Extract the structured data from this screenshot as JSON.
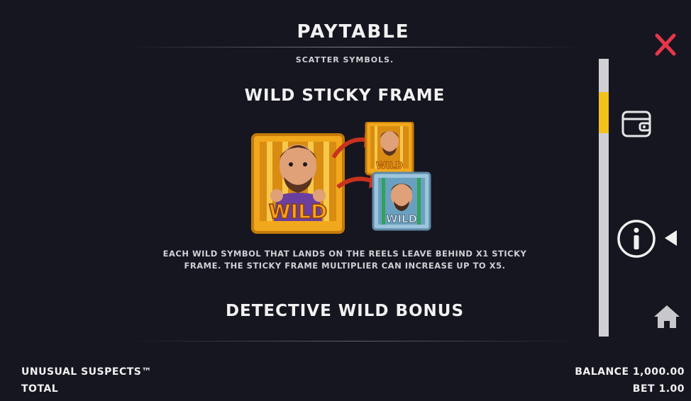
{
  "header": {
    "title": "PAYTABLE"
  },
  "content": {
    "top_cut_text": "SCATTER SYMBOLS.",
    "sections": [
      {
        "title": "WILD STICKY FRAME",
        "illustration_text": "WILD",
        "description_line1": "EACH WILD SYMBOL THAT LANDS ON THE REELS LEAVE BEHIND X1 STICKY",
        "description_line2": "FRAME. THE STICKY FRAME MULTIPLIER CAN INCREASE UP TO X5."
      },
      {
        "title": "DETECTIVE WILD BONUS"
      }
    ]
  },
  "scrollbar": {
    "position_fraction": 0.14
  },
  "sidebar": {
    "icons": [
      "wallet-icon",
      "info-icon",
      "triangle-left-icon",
      "home-icon"
    ]
  },
  "footer": {
    "game_name": "UNUSUAL SUSPECTS™",
    "total_label": "TOTAL",
    "balance_label": "BALANCE",
    "balance_value": "1,000.00",
    "bet_label": "BET",
    "bet_value": "1.00"
  },
  "colors": {
    "background": "#161620",
    "close_icon": "#e8364a",
    "scroll_thumb": "#f2c21a",
    "scroll_track": "#cfcfd4",
    "gold_frame": "#f2a81c",
    "silver_frame": "#9cc4dc"
  }
}
